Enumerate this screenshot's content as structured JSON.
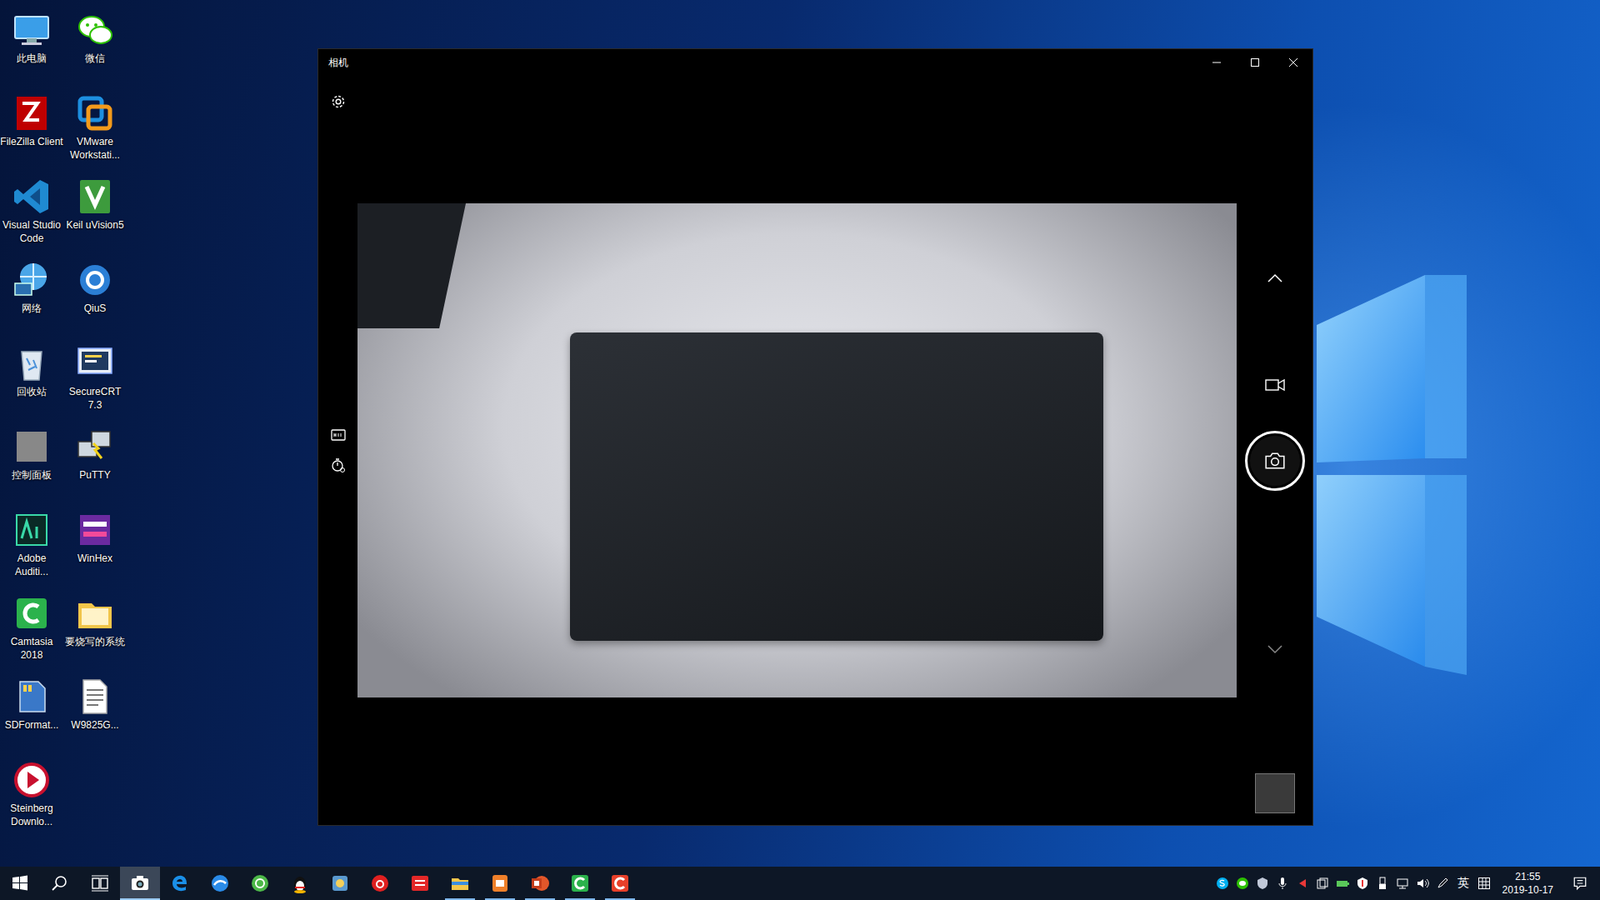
{
  "desktop": {
    "icons": [
      {
        "label": "此电脑",
        "kind": "pc"
      },
      {
        "label": "FileZilla Client",
        "kind": "filezilla"
      },
      {
        "label": "Visual Studio Code",
        "kind": "vscode"
      },
      {
        "label": "网络",
        "kind": "network"
      },
      {
        "label": "回收站",
        "kind": "recycle"
      },
      {
        "label": "控制面板",
        "kind": "control"
      },
      {
        "label": "Adobe Auditi...",
        "kind": "audition"
      },
      {
        "label": "Camtasia 2018",
        "kind": "camtasia"
      },
      {
        "label": "SDFormat...",
        "kind": "sdformat"
      },
      {
        "label": "Steinberg Downlo...",
        "kind": "steinberg"
      },
      {
        "label": "微信",
        "kind": "wechat"
      },
      {
        "label": "VMware Workstati...",
        "kind": "vmware"
      },
      {
        "label": "Keil uVision5",
        "kind": "keil"
      },
      {
        "label": "QiuS",
        "kind": "qius"
      },
      {
        "label": "SecureCRT 7.3",
        "kind": "securecrt"
      },
      {
        "label": "PuTTY",
        "kind": "putty"
      },
      {
        "label": "WinHex",
        "kind": "winhex"
      },
      {
        "label": "要烧写的系统",
        "kind": "folder"
      },
      {
        "label": "W9825G...",
        "kind": "doc"
      }
    ]
  },
  "window": {
    "title": "相机"
  },
  "camera": {
    "mode": "photo"
  },
  "taskbar": {
    "apps": [
      {
        "kind": "start",
        "running": false,
        "active": false
      },
      {
        "kind": "search",
        "running": false,
        "active": false
      },
      {
        "kind": "taskview",
        "running": false,
        "active": false
      },
      {
        "kind": "camera",
        "running": true,
        "active": true
      },
      {
        "kind": "edge",
        "running": false,
        "active": false
      },
      {
        "kind": "browser",
        "running": false,
        "active": false
      },
      {
        "kind": "safe",
        "running": false,
        "active": false
      },
      {
        "kind": "qq",
        "running": false,
        "active": false
      },
      {
        "kind": "game",
        "running": false,
        "active": false
      },
      {
        "kind": "music",
        "running": false,
        "active": false
      },
      {
        "kind": "dict",
        "running": false,
        "active": false
      },
      {
        "kind": "explorer",
        "running": true,
        "active": false
      },
      {
        "kind": "wps",
        "running": true,
        "active": false
      },
      {
        "kind": "ppt",
        "running": true,
        "active": false
      },
      {
        "kind": "camtasia",
        "running": true,
        "active": false
      },
      {
        "kind": "recorder",
        "running": true,
        "active": false
      }
    ],
    "tray": {
      "icons": [
        "skype",
        "wechat",
        "shield",
        "mic",
        "arrow",
        "copy",
        "battery",
        "guard",
        "usb",
        "network",
        "volume",
        "pen"
      ],
      "language": "英",
      "time": "21:55",
      "date": "2019-10-17"
    }
  }
}
